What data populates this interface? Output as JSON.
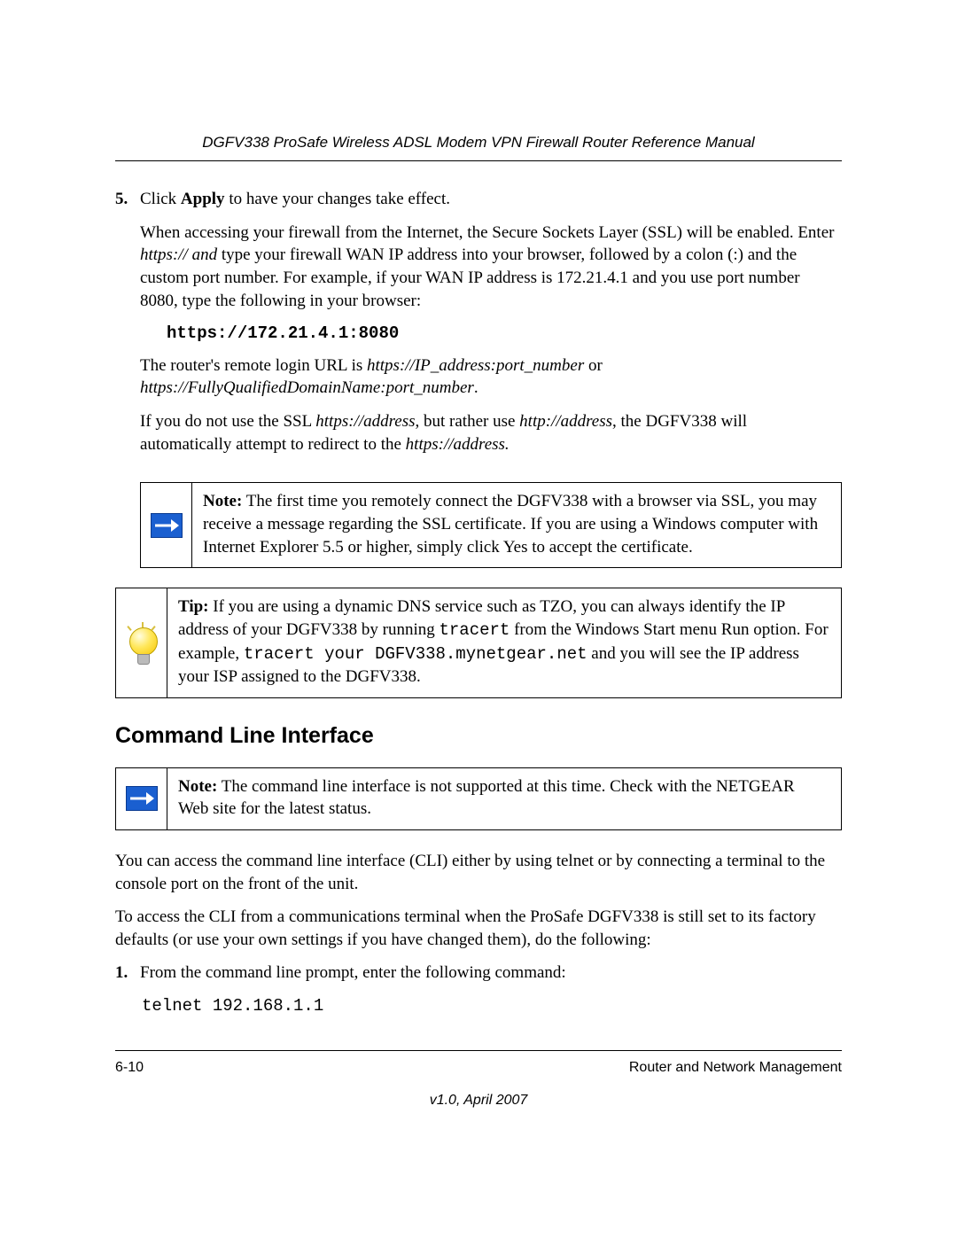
{
  "header": {
    "running_head": "DGFV338 ProSafe Wireless ADSL Modem VPN Firewall Router Reference Manual"
  },
  "step5": {
    "number": "5.",
    "line1_a": "Click ",
    "line1_bold": "Apply",
    "line1_b": " to have your changes take effect.",
    "p2_a": "When accessing your firewall from the Internet, the Secure Sockets Layer (SSL) will be enabled. Enter ",
    "p2_ital": "https:// and",
    "p2_b": " type your firewall WAN IP address into your browser, followed by a colon (:) and the custom port number. For example, if your WAN IP address is 172.21.4.1 and you use port number 8080, type the following in your browser:",
    "code": "https://172.21.4.1:8080",
    "p3_a": "The router's remote login URL is ",
    "p3_i1": "https://IP_address:port_number",
    "p3_b": " or ",
    "p3_i2": "https://FullyQualifiedDomainName:port_number",
    "p3_c": ".",
    "p4_a": "If you do not use the SSL ",
    "p4_i1": "https://address",
    "p4_b": ", but rather use ",
    "p4_i2": "http://address",
    "p4_c": ", the DGFV338 will automatically attempt to redirect to the ",
    "p4_i3": "https://address.",
    "p4_d": ""
  },
  "note1": {
    "label": "Note:",
    "text": " The first time you remotely connect the DGFV338 with a browser via SSL, you may receive a message regarding the SSL certificate. If you are using a Windows computer with Internet Explorer 5.5 or higher, simply click Yes to accept the certificate."
  },
  "tip": {
    "label": "Tip:",
    "a": " If you are using a dynamic DNS service such as TZO, you can always identify the IP address of your DGFV338 by running ",
    "m1": "tracert",
    "b": " from the Windows Start menu Run option. For example, ",
    "m2": "tracert your DGFV338.mynetgear.net",
    "c": " and you will see the IP address your ISP assigned to the DGFV338."
  },
  "section_heading": "Command Line Interface",
  "note2": {
    "label": "Note:",
    "text": " The command line interface is not supported at this time. Check with the NETGEAR Web site for the latest status."
  },
  "body": {
    "p1": "You can access the command line interface (CLI) either by using telnet or by connecting a terminal to the console port on the front of the unit.",
    "p2": "To access the CLI from a communications terminal when the ProSafe DGFV338 is still set to its factory defaults (or use your own settings if you have changed them), do the following:"
  },
  "step1": {
    "number": "1.",
    "text": "From the command line prompt, enter the following command:",
    "code": "telnet 192.168.1.1"
  },
  "footer": {
    "page": "6-10",
    "chapter": "Router and Network Management",
    "version": "v1.0, April 2007"
  }
}
